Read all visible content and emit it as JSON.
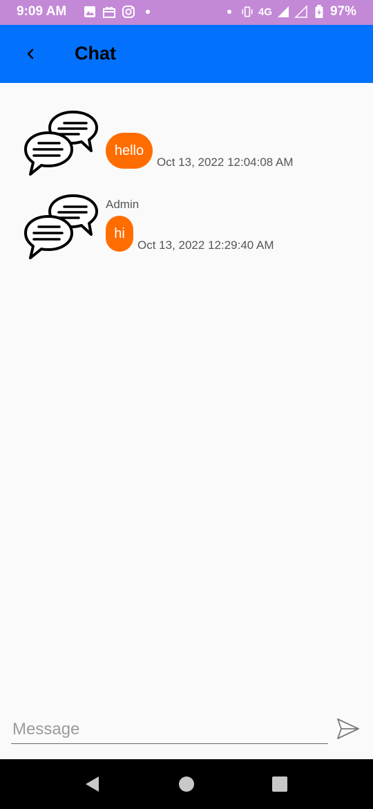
{
  "status_bar": {
    "time": "9:09 AM",
    "network": "4G",
    "battery": "97%",
    "icons": [
      "image-icon",
      "gift-icon",
      "instagram-icon",
      "dot-icon",
      "dot-icon",
      "vibrate-icon",
      "signal-icon",
      "signal-empty-icon",
      "battery-charging-icon"
    ]
  },
  "app_bar": {
    "title": "Chat",
    "back_icon": "chevron-left-icon",
    "background": "#0272fe"
  },
  "messages": [
    {
      "sender": "",
      "text": "hello",
      "timestamp": "Oct 13, 2022 12:04:08 AM",
      "avatar_icon": "chat-bubbles-icon"
    },
    {
      "sender": "Admin",
      "text": "hi",
      "timestamp": "Oct 13, 2022 12:29:40 AM",
      "avatar_icon": "chat-bubbles-icon"
    }
  ],
  "composer": {
    "placeholder": "Message",
    "value": "",
    "send_icon": "send-icon"
  },
  "nav_bar": {
    "icons": [
      "back-triangle-icon",
      "home-circle-icon",
      "recents-square-icon"
    ]
  },
  "colors": {
    "accent": "#ff6d00",
    "status_bar": "#c389d6"
  }
}
